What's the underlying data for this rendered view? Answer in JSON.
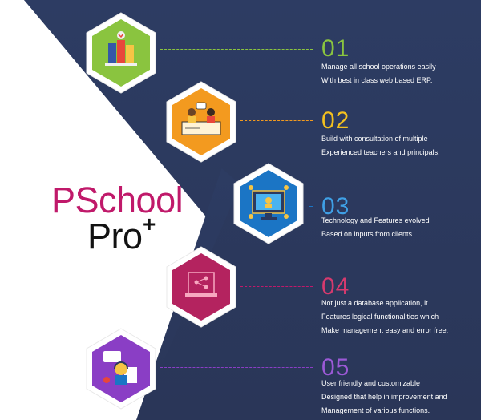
{
  "brand": {
    "line1": "PSchool",
    "line2": "Pro",
    "plus": "+"
  },
  "colors": {
    "navy": "#2b3a60",
    "green": "#8ac43f",
    "orange": "#f39a1f",
    "blue": "#1b75c5",
    "magenta": "#b4235f",
    "purple": "#8a3ec5",
    "brand_pink": "#c0196a"
  },
  "steps": [
    {
      "number": "01",
      "lines": [
        "Manage all school operations easily",
        "With best in class web based ERP."
      ],
      "icon": "school-operations-icon"
    },
    {
      "number": "02",
      "lines": [
        "Build with consultation of multiple",
        "Experienced teachers and principals."
      ],
      "icon": "teachers-consultation-icon"
    },
    {
      "number": "03",
      "lines": [
        "Technology and Features evolved",
        "Based on inputs from clients."
      ],
      "icon": "technology-monitor-icon"
    },
    {
      "number": "04",
      "lines": [
        "Not just a database application, it",
        "Features logical functionalities which",
        "Make management easy and error free."
      ],
      "icon": "database-laptop-icon"
    },
    {
      "number": "05",
      "lines": [
        "User friendly and customizable",
        "Designed that help in improvement and",
        "Management of various functions."
      ],
      "icon": "user-support-icon"
    }
  ]
}
